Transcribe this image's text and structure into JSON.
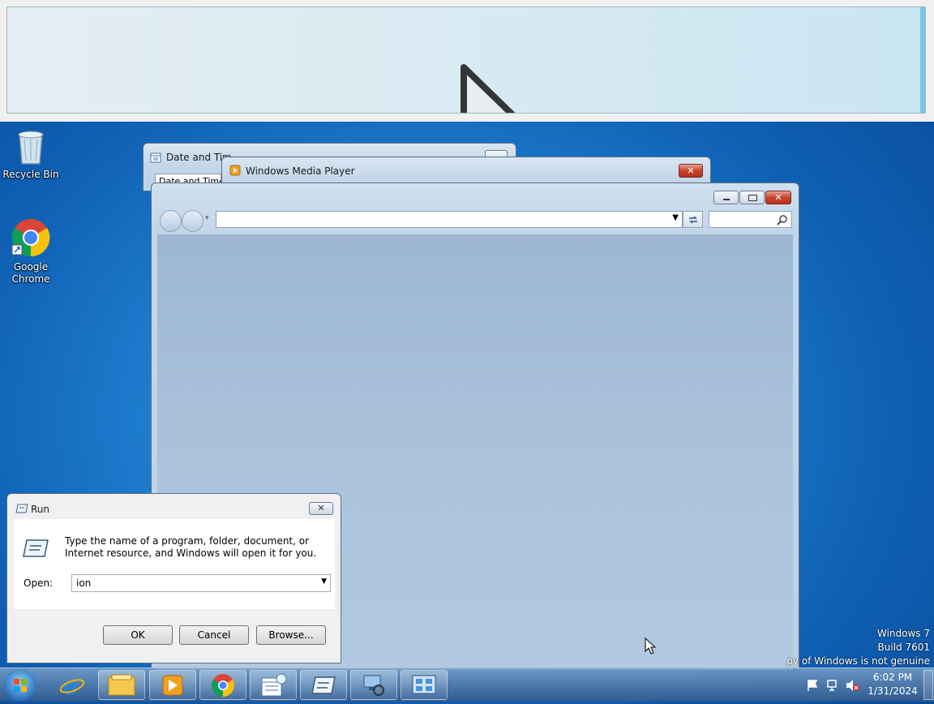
{
  "magnifier": {},
  "desktop": {
    "icons": [
      {
        "label": "Recycle Bin",
        "icon": "recycle-bin-icon"
      },
      {
        "label": "Google Chrome",
        "icon": "chrome-icon"
      }
    ]
  },
  "datetime_window": {
    "title": "Date and Tim",
    "tab": "Date and Time"
  },
  "wmp_window": {
    "title": "Windows Media Player"
  },
  "explorer": {
    "address_value": "",
    "search_placeholder": ""
  },
  "run_dialog": {
    "title": "Run",
    "description": "Type the name of a program, folder, document, or Internet resource, and Windows will open it for you.",
    "open_label": "Open:",
    "open_value": "ion",
    "ok": "OK",
    "cancel": "Cancel",
    "browse": "Browse..."
  },
  "watermark": {
    "line1": "Windows 7",
    "line2": "Build 7601",
    "line3": "py of Windows is not genuine"
  },
  "taskbar": {
    "pinned": [
      "start-orb-icon",
      "internet-explorer-icon",
      "file-explorer-icon",
      "media-player-icon",
      "chrome-icon",
      "date-time-icon",
      "run-icon",
      "network-icon",
      "control-panel-icon"
    ],
    "clock": {
      "time": "6:02 PM",
      "date": "1/31/2024"
    }
  }
}
